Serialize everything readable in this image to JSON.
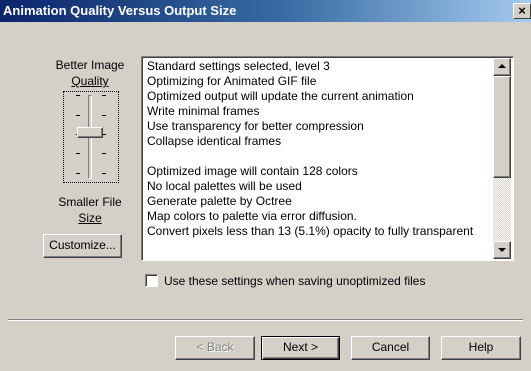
{
  "window": {
    "title": "Animation Quality Versus Output Size",
    "close_glyph": "×"
  },
  "slider": {
    "top_label_line1": "Better Image",
    "top_label_line2": "Quality",
    "bottom_label_line1": "Smaller File",
    "bottom_label_line2": "Size",
    "level": 3,
    "customize_label": "Customize..."
  },
  "settings_list": {
    "lines": [
      "Standard settings selected, level 3",
      "Optimizing for Animated GIF file",
      "Optimized output will update the current animation",
      "Write minimal frames",
      "Use transparency for better compression",
      "Collapse identical frames",
      "",
      "Optimized image will contain 128 colors",
      "No local palettes will be used",
      "Generate palette by Octree",
      "Map colors to palette via error diffusion.",
      "Convert pixels less than 13 (5.1%) opacity to fully transparent"
    ]
  },
  "checkbox": {
    "label": "Use these settings when saving unoptimized files",
    "checked": false
  },
  "buttons": {
    "back": "< Back",
    "next": "Next >",
    "cancel": "Cancel",
    "help": "Help"
  },
  "icons": {
    "close": "close-icon",
    "scroll_up": "arrow-up-icon",
    "scroll_down": "arrow-down-icon"
  },
  "colors": {
    "title_bar_start": "#0a246a",
    "title_bar_end": "#a6caf0",
    "face": "#d4d0c8"
  }
}
